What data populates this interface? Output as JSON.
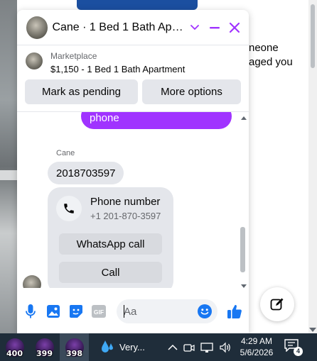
{
  "background": {
    "text_lines": [
      "neone",
      "aged you"
    ]
  },
  "chat": {
    "title": "Cane · 1 Bed 1 Bath Apart...",
    "header_icons": [
      "chevron-down-icon",
      "minimize-icon",
      "close-icon"
    ],
    "marketplace": {
      "label": "Marketplace",
      "listing": "$1,150 - 1 Bed 1 Bath Apartment"
    },
    "actions": {
      "pending_label": "Mark as pending",
      "more_label": "More options"
    },
    "messages": {
      "sent_text": "phone",
      "sender_name": "Cane",
      "number_text": "2018703597",
      "phone_card": {
        "title": "Phone number",
        "number": "+1 201-870-3597",
        "whatsapp_label": "WhatsApp call",
        "call_label": "Call"
      }
    },
    "composer": {
      "placeholder": "Aa",
      "icons": [
        "microphone-icon",
        "image-icon",
        "sticker-icon",
        "gif-icon",
        "emoji-icon",
        "thumbs-up-icon"
      ],
      "gif_text": "GIF"
    },
    "accent_color": "#a033ff",
    "icon_color": "#1877f2"
  },
  "taskbar": {
    "apps": [
      {
        "badge": "400"
      },
      {
        "badge": "399"
      },
      {
        "badge": "398"
      }
    ],
    "weather": "Very...",
    "time": "4:29 AM",
    "date": "5/6/2026",
    "notifications": "4"
  }
}
